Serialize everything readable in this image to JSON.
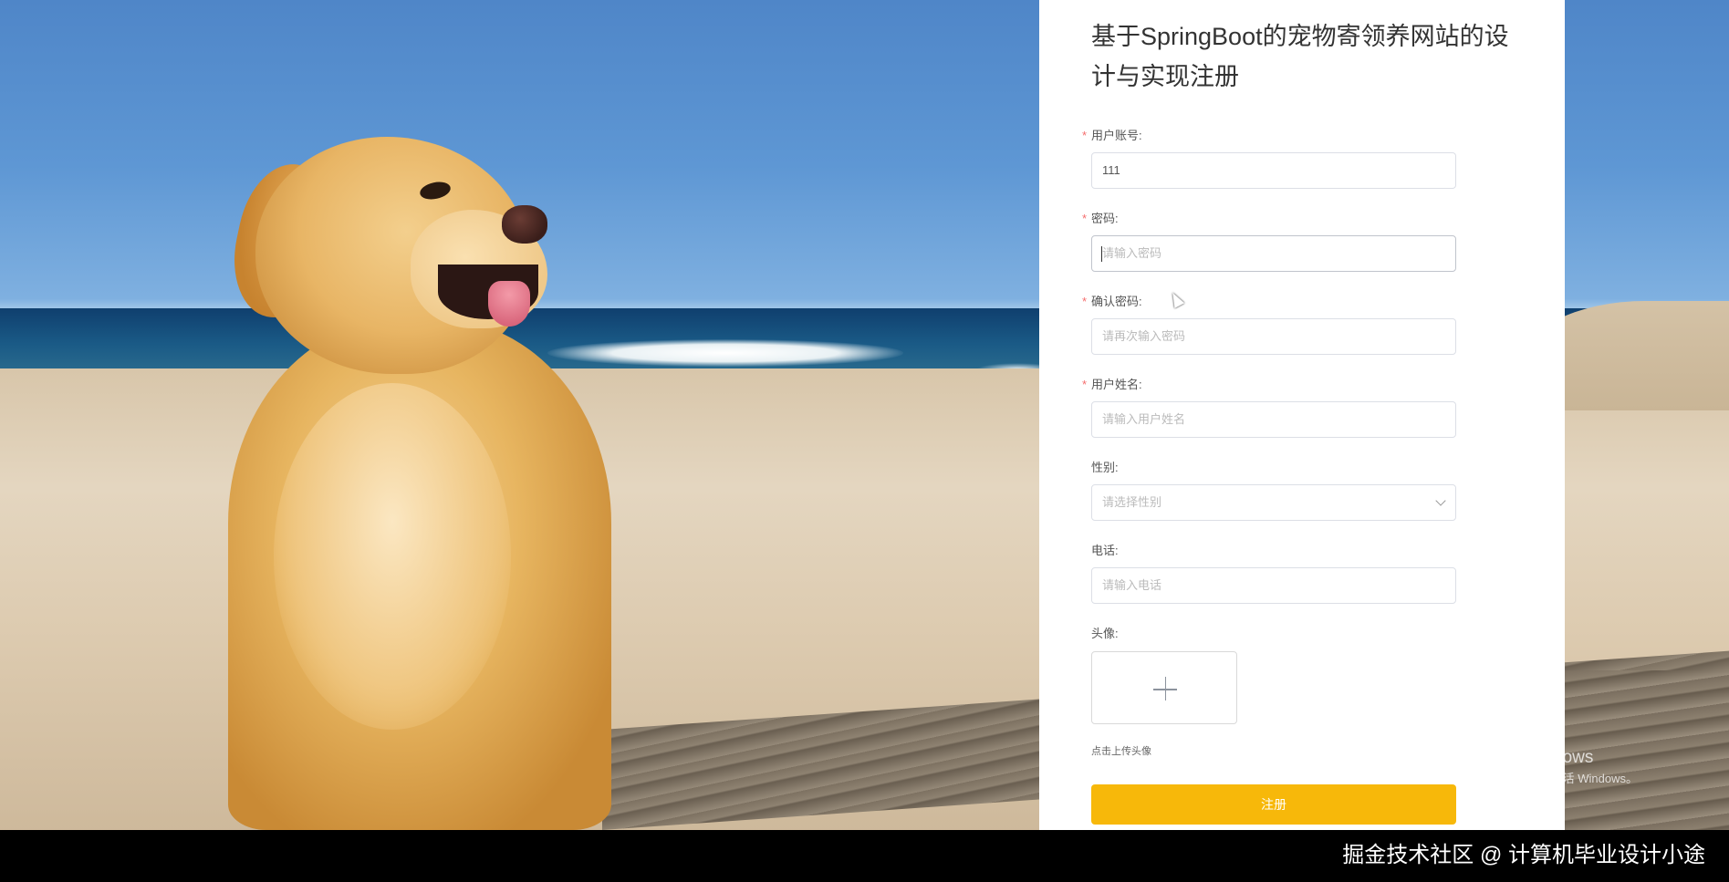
{
  "form": {
    "title": "基于SpringBoot的宠物寄领养网站的设计与实现注册",
    "fields": {
      "account": {
        "label": "用户账号:",
        "value": "111",
        "required": true
      },
      "password": {
        "label": "密码:",
        "placeholder": "请输入密码",
        "required": true
      },
      "confirm_password": {
        "label": "确认密码:",
        "placeholder": "请再次输入密码",
        "required": true
      },
      "real_name": {
        "label": "用户姓名:",
        "placeholder": "请输入用户姓名",
        "required": true
      },
      "gender": {
        "label": "性别:",
        "placeholder": "请选择性别",
        "required": false
      },
      "phone": {
        "label": "电话:",
        "placeholder": "请输入电话",
        "required": false
      },
      "avatar": {
        "label": "头像:",
        "tip": "点击上传头像",
        "required": false
      }
    },
    "required_mark": "*",
    "submit_label": "注册",
    "accent_color": "#f7b80a"
  },
  "watermark": {
    "line1": "激活 Windows",
    "line2": "转到“设置”以激活 Windows。"
  },
  "credit": "掘金技术社区 @ 计算机毕业设计小途",
  "icons": [
    "plus-icon",
    "chevron-down-icon",
    "mouse-cursor-icon"
  ]
}
